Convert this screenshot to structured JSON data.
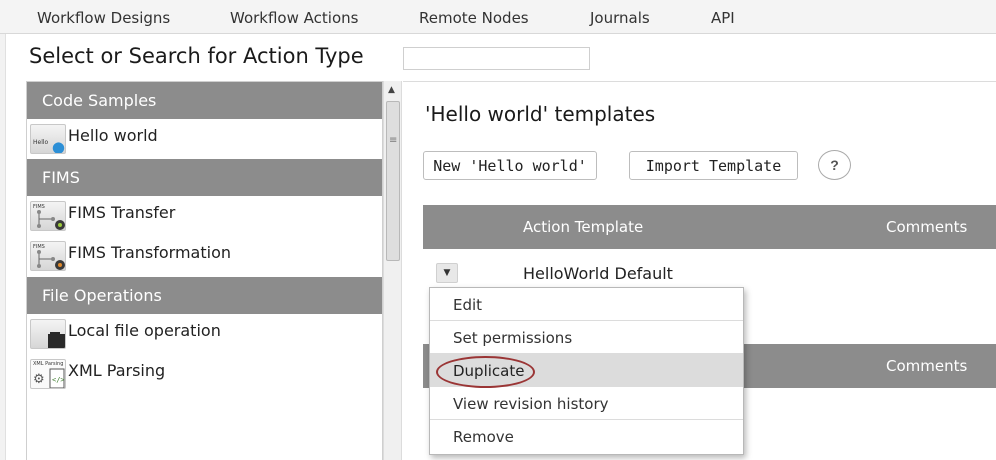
{
  "topnav": {
    "items": [
      "Workflow Designs",
      "Workflow Actions",
      "Remote Nodes",
      "Journals",
      "API"
    ]
  },
  "page": {
    "title": "Select or Search for Action Type",
    "search_value": ""
  },
  "action_types": {
    "categories": [
      {
        "label": "Code Samples",
        "items": [
          {
            "label": "Hello world",
            "icon": "hello-world-icon",
            "thumb_text": "Hello"
          }
        ]
      },
      {
        "label": "FIMS",
        "items": [
          {
            "label": "FIMS Transfer",
            "icon": "fims-transfer-icon",
            "thumb_text": "FIMS"
          },
          {
            "label": "FIMS Transformation",
            "icon": "fims-transformation-icon",
            "thumb_text": "FIMS"
          }
        ]
      },
      {
        "label": "File Operations",
        "items": [
          {
            "label": "Local file operation",
            "icon": "local-file-icon",
            "thumb_text": ""
          },
          {
            "label": "XML Parsing",
            "icon": "xml-parsing-icon",
            "thumb_text": "XML Parsing"
          }
        ]
      }
    ]
  },
  "templates": {
    "title": "'Hello world' templates",
    "new_button": "New 'Hello world'",
    "import_button": "Import Template",
    "help_label": "?",
    "columns": {
      "action_template": "Action Template",
      "comments": "Comments"
    },
    "second_columns": {
      "comments": "Comments"
    },
    "rows": [
      {
        "name": "HelloWorld Default"
      }
    ]
  },
  "context_menu": {
    "items": [
      "Edit",
      "Set permissions",
      "Duplicate",
      "View revision history",
      "Remove"
    ],
    "active": "Duplicate"
  },
  "colors": {
    "header_gray": "#8c8c8c",
    "highlight_ring": "#9a3535",
    "menu_active": "#dcdcdc"
  }
}
